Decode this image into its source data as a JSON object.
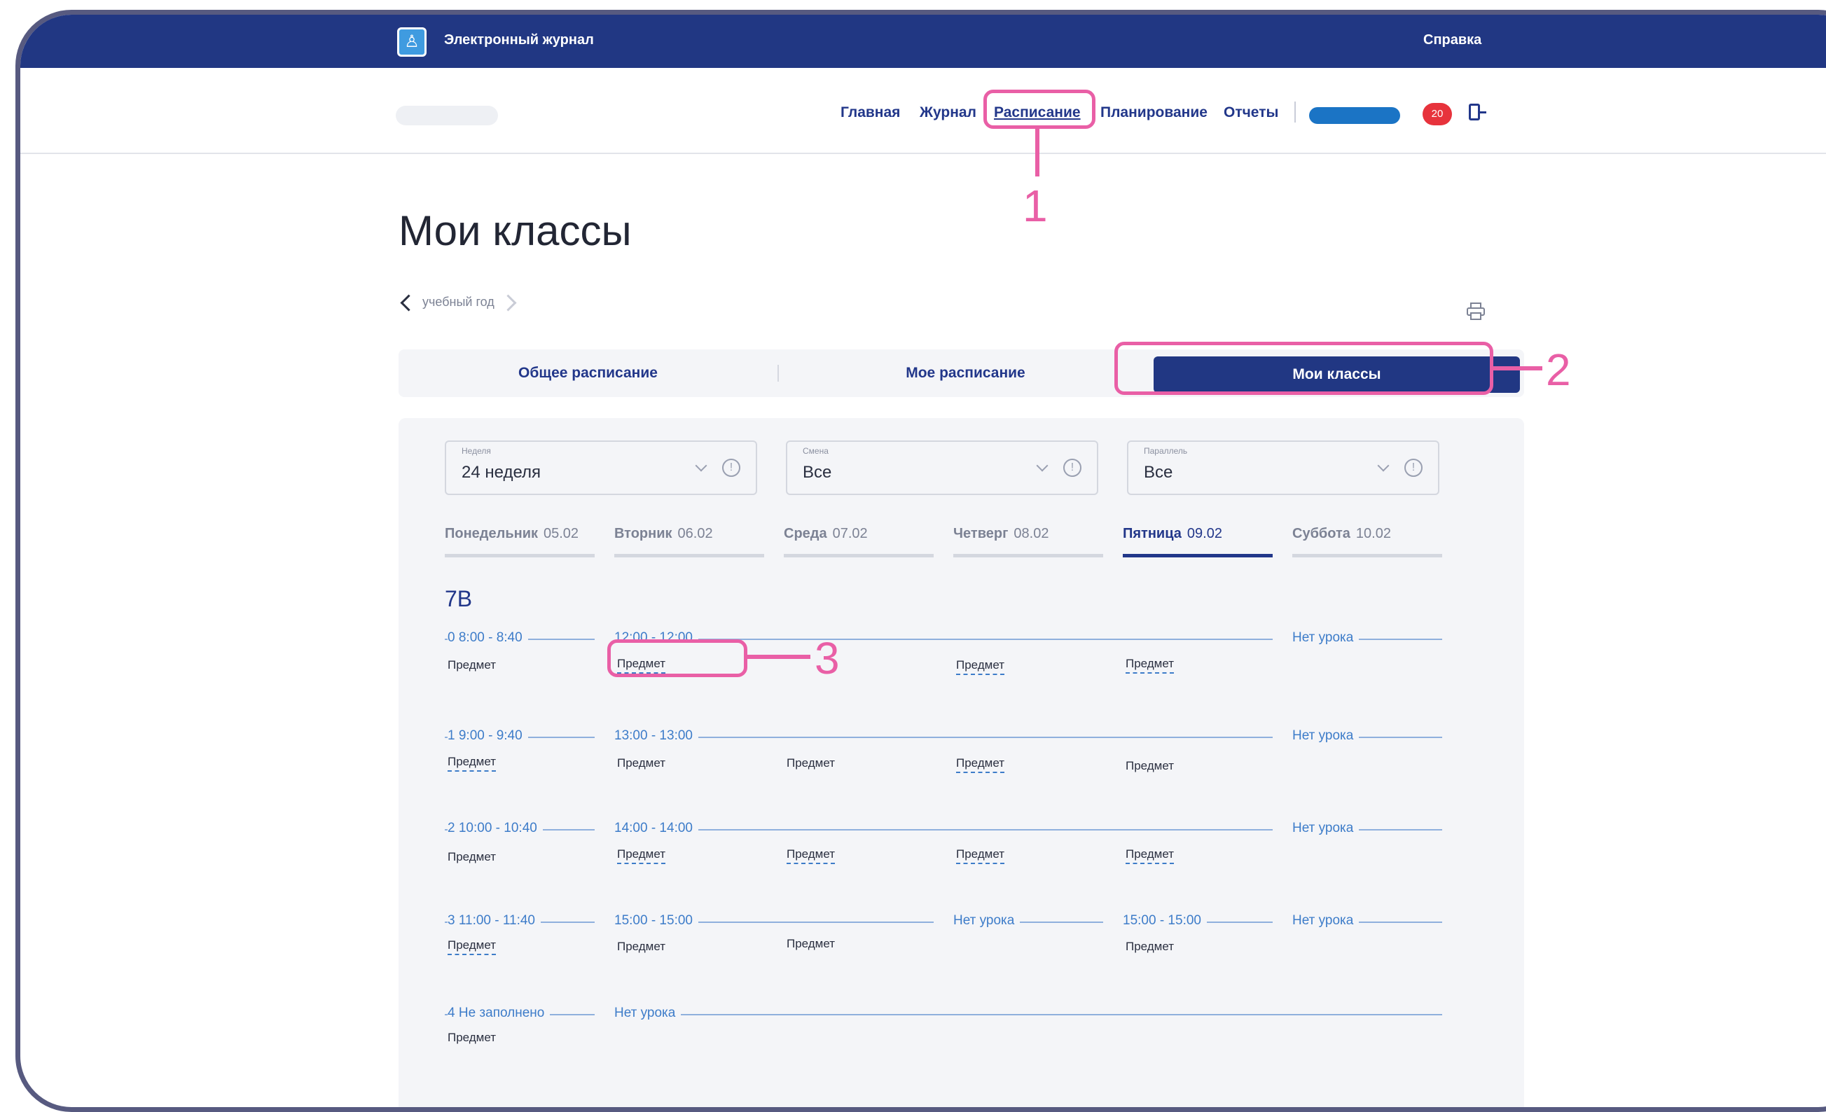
{
  "app": {
    "title": "Электронный журнал",
    "help": "Справка"
  },
  "nav": {
    "items": [
      {
        "label": "Главная"
      },
      {
        "label": "Журнал"
      },
      {
        "label": "Расписание"
      },
      {
        "label": "Планирование"
      },
      {
        "label": "Отчеты"
      }
    ],
    "notifications_count": "20"
  },
  "callouts": [
    "1",
    "2",
    "3"
  ],
  "page": {
    "title": "Мои классы",
    "year_label": "учебный год"
  },
  "tabs": [
    "Общее расписание",
    "Мое расписание",
    "Мои классы"
  ],
  "filters": [
    {
      "label": "Неделя",
      "value": "24 неделя"
    },
    {
      "label": "Смена",
      "value": "Все"
    },
    {
      "label": "Параллель",
      "value": "Все"
    }
  ],
  "days": [
    {
      "name": "Понедельник",
      "date": "05.02"
    },
    {
      "name": "Вторник",
      "date": "06.02"
    },
    {
      "name": "Среда",
      "date": "07.02"
    },
    {
      "name": "Четверг",
      "date": "08.02"
    },
    {
      "name": "Пятница",
      "date": "09.02"
    },
    {
      "name": "Суббота",
      "date": "10.02"
    }
  ],
  "class_name": "7В",
  "schedule": {
    "l0": {
      "time": "0  8:00 - 8:40",
      "tue_time": "12:00 - 12:00",
      "sat": "Нет урока",
      "s": [
        "Предмет",
        "Предмет",
        "Предмет",
        "Предмет"
      ]
    },
    "l1": {
      "time": "1  9:00 - 9:40",
      "tue_time": "13:00 - 13:00",
      "sat": "Нет урока",
      "s": [
        "Предмет",
        "Предмет",
        "Предмет",
        "Предмет",
        "Предмет"
      ]
    },
    "l2": {
      "time": "2  10:00 - 10:40",
      "tue_time": "14:00 - 14:00",
      "sat": "Нет урока",
      "s": [
        "Предмет",
        "Предмет",
        "Предмет",
        "Предмет",
        "Предмет"
      ]
    },
    "l3": {
      "time": "3  11:00 - 11:40",
      "tue_time": "15:00 - 15:00",
      "thu": "Нет урока",
      "fri_time": "15:00 - 15:00",
      "sat": "Нет урока",
      "s": [
        "Предмет",
        "Предмет",
        "Предмет",
        "Предмет"
      ]
    },
    "l4": {
      "time": "4  Не заполнено",
      "tue": "Нет урока",
      "s": [
        "Предмет"
      ]
    }
  }
}
